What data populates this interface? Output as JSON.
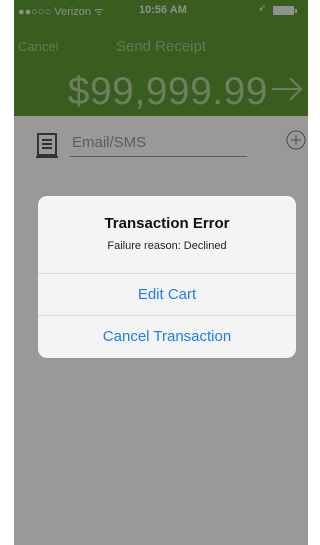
{
  "status_bar": {
    "carrier": "●●○○○ Verizon",
    "wifi_icon": "wifi-icon",
    "time": "10:56 AM",
    "location_icon": "location-arrow-icon",
    "battery_icon": "battery-icon"
  },
  "nav": {
    "cancel_label": "Cancel",
    "title": "Send Receipt"
  },
  "amount": {
    "value": "$99,999.99",
    "arrow_icon": "right-arrow-icon"
  },
  "receipt": {
    "icon": "receipt-icon",
    "placeholder": "Email/SMS",
    "add_icon": "plus-circle-icon"
  },
  "alert": {
    "title": "Transaction Error",
    "message": "Failure reason: Declined",
    "buttons": [
      "Edit Cart",
      "Cancel Transaction"
    ]
  },
  "colors": {
    "header_green": "#5e9b35",
    "link_blue": "#1a7ef0"
  }
}
